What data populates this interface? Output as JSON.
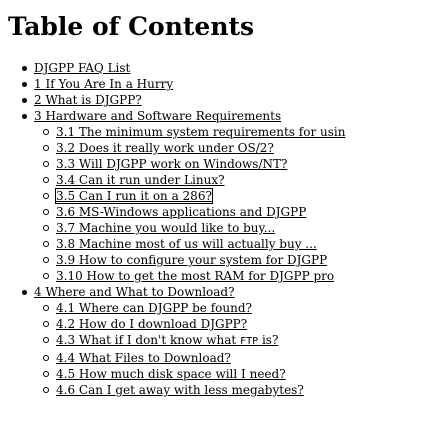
{
  "title": "Table of Contents",
  "toc": [
    {
      "label": "DJGPP FAQ List"
    },
    {
      "label": "1 If You Are In a Hurry"
    },
    {
      "label": "2 What is DJGPP?"
    },
    {
      "label": "3 Hardware and Software Requirements",
      "children": [
        {
          "label": "3.1 The minimum system requirements for usin"
        },
        {
          "label": "3.2 Does it really work under OS/2?"
        },
        {
          "label": "3.3 Will DJGPP work on Windows/NT?"
        },
        {
          "label": "3.4 Can it run under Linux?"
        },
        {
          "label": "3.5 Can I run it on a 286?",
          "focused": true
        },
        {
          "label": "3.6 MS-Windows applications and DJGPP"
        },
        {
          "label": "3.7 Machine you would like to buy..."
        },
        {
          "label": "3.8 Machine most of us will actually buy ..."
        },
        {
          "label": "3.9 How to configure your system for DJGPP"
        },
        {
          "label": "3.10 How to get the most RAM for DJGPP pro"
        }
      ]
    },
    {
      "label": "4 Where and What to Download?",
      "children": [
        {
          "label": "4.1 Where can DJGPP be found?"
        },
        {
          "label": "4.2 How do I download DJGPP?"
        },
        {
          "label_pre": "4.3 What if I don't know what ",
          "label_code": "FTP",
          "label_post": " is?"
        },
        {
          "label": "4.4 What Files to Download?"
        },
        {
          "label": "4.5 How much disk space will I need?"
        },
        {
          "label": "4.6 Can I get away with less megabytes?"
        }
      ]
    }
  ]
}
